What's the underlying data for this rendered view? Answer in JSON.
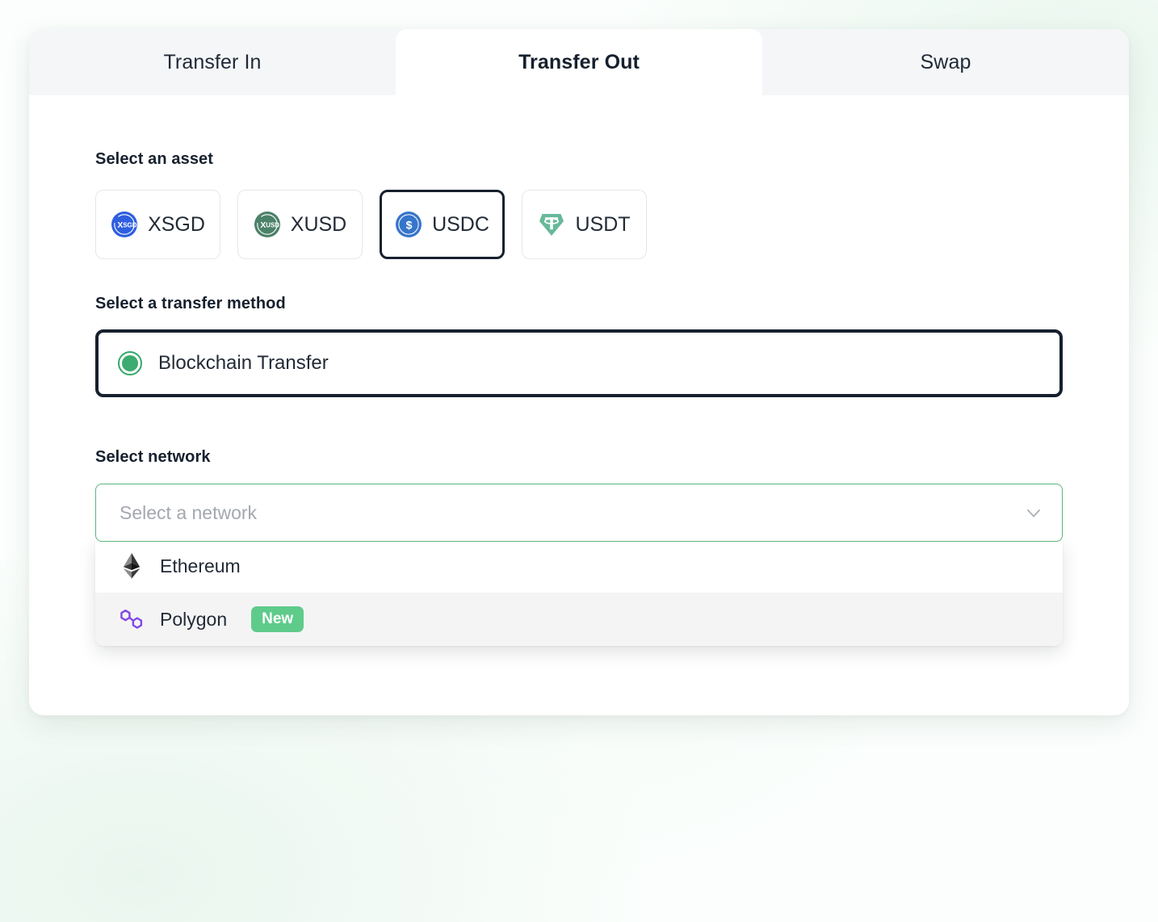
{
  "tabs": [
    {
      "label": "Transfer In",
      "active": false
    },
    {
      "label": "Transfer Out",
      "active": true
    },
    {
      "label": "Swap",
      "active": false
    }
  ],
  "asset_section": {
    "label": "Select an asset",
    "options": [
      {
        "symbol": "XSGD",
        "icon": "xsgd-coin-icon",
        "selected": false
      },
      {
        "symbol": "XUSD",
        "icon": "xusd-coin-icon",
        "selected": false
      },
      {
        "symbol": "USDC",
        "icon": "usdc-coin-icon",
        "selected": true
      },
      {
        "symbol": "USDT",
        "icon": "usdt-coin-icon",
        "selected": false
      }
    ]
  },
  "method_section": {
    "label": "Select a transfer method",
    "options": [
      {
        "label": "Blockchain Transfer",
        "selected": true
      }
    ]
  },
  "network_section": {
    "label": "Select network",
    "placeholder": "Select a network",
    "value": "",
    "chevron": "chevron-down-icon",
    "options": [
      {
        "label": "Ethereum",
        "icon": "ethereum-icon",
        "badge": "",
        "hovered": false
      },
      {
        "label": "Polygon",
        "icon": "polygon-icon",
        "badge": "New",
        "hovered": true
      }
    ]
  },
  "colors": {
    "accent_green": "#3dab6f",
    "badge_green": "#5ecb8b",
    "select_border_green": "#5bb57f",
    "dark_navy": "#16202e",
    "tab_bar_bg": "#f4f6f8",
    "xsgd_blue": "#2f5fe0",
    "xusd_green": "#4b8268",
    "usdc_blue": "#3775cb",
    "usdt_green": "#67b99a",
    "polygon_purple": "#8247e5",
    "page_bg": "#fbfefc"
  }
}
